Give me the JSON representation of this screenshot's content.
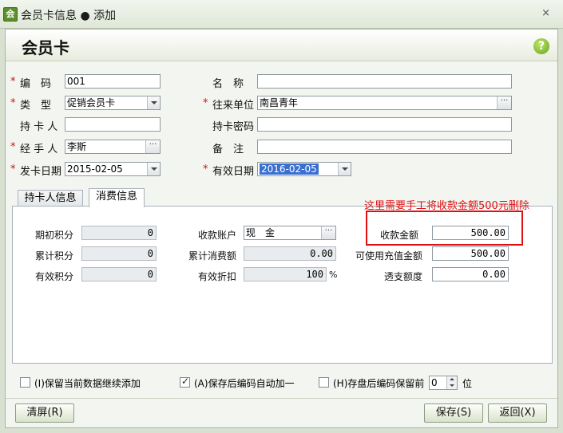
{
  "window": {
    "title": "会员卡信息 ● 添加",
    "app_icon": "会",
    "close_glyph": "×"
  },
  "header": {
    "title": "会员卡",
    "help_glyph": "?"
  },
  "form": {
    "code": {
      "label": "编　码",
      "value": "001",
      "required": true
    },
    "name": {
      "label": "名　称",
      "value": ""
    },
    "type": {
      "label": "类　型",
      "value": "促销会员卡",
      "required": true
    },
    "partner": {
      "label": "往来单位",
      "value": "南昌青年",
      "required": true
    },
    "holder": {
      "label": "持 卡 人",
      "value": ""
    },
    "password": {
      "label": "持卡密码",
      "value": ""
    },
    "handler": {
      "label": "经 手 人",
      "value": "李斯",
      "required": true
    },
    "remark": {
      "label": "备　注",
      "value": ""
    },
    "issue_date": {
      "label": "发卡日期",
      "value": "2015-02-05",
      "required": true
    },
    "expire_date": {
      "label": "有效日期",
      "value": "2016-02-05",
      "required": true
    }
  },
  "tabs": [
    {
      "label": "持卡人信息",
      "active": false
    },
    {
      "label": "消费信息",
      "active": true
    }
  ],
  "consume": {
    "initial_points": {
      "label": "期初积分",
      "value": "0"
    },
    "total_points": {
      "label": "累计积分",
      "value": "0"
    },
    "valid_points": {
      "label": "有效积分",
      "value": "0"
    },
    "account": {
      "label": "收款账户",
      "value": "现　金"
    },
    "total_spend": {
      "label": "累计消费额",
      "value": "0.00"
    },
    "discount": {
      "label": "有效折扣",
      "value": "100",
      "unit": "%"
    },
    "received_amount": {
      "label": "收款金额",
      "value": "500.00"
    },
    "usable_balance": {
      "label": "可使用充值金额",
      "value": "500.00"
    },
    "overdraft": {
      "label": "透支额度",
      "value": "0.00"
    }
  },
  "annotation": {
    "text": "这里需要手工将收款金额500元删除",
    "color": "#e11010"
  },
  "options": {
    "keep_data": {
      "label": "(I)保留当前数据继续添加",
      "checked": false
    },
    "auto_increment": {
      "label": "(A)保存后编码自动加一",
      "checked": true
    },
    "keep_code": {
      "label": "(H)存盘后编码保留前",
      "checked": false
    },
    "keep_digits": "0",
    "digits_unit": "位"
  },
  "buttons": {
    "clear": "清屏(R)",
    "save": "保存(S)",
    "back": "返回(X)"
  },
  "symbols": {
    "required_mark": "*",
    "dots": "···"
  },
  "colors": {
    "required": "#d01010",
    "selection": "#3a6fd0",
    "accent": "#63a51c"
  }
}
